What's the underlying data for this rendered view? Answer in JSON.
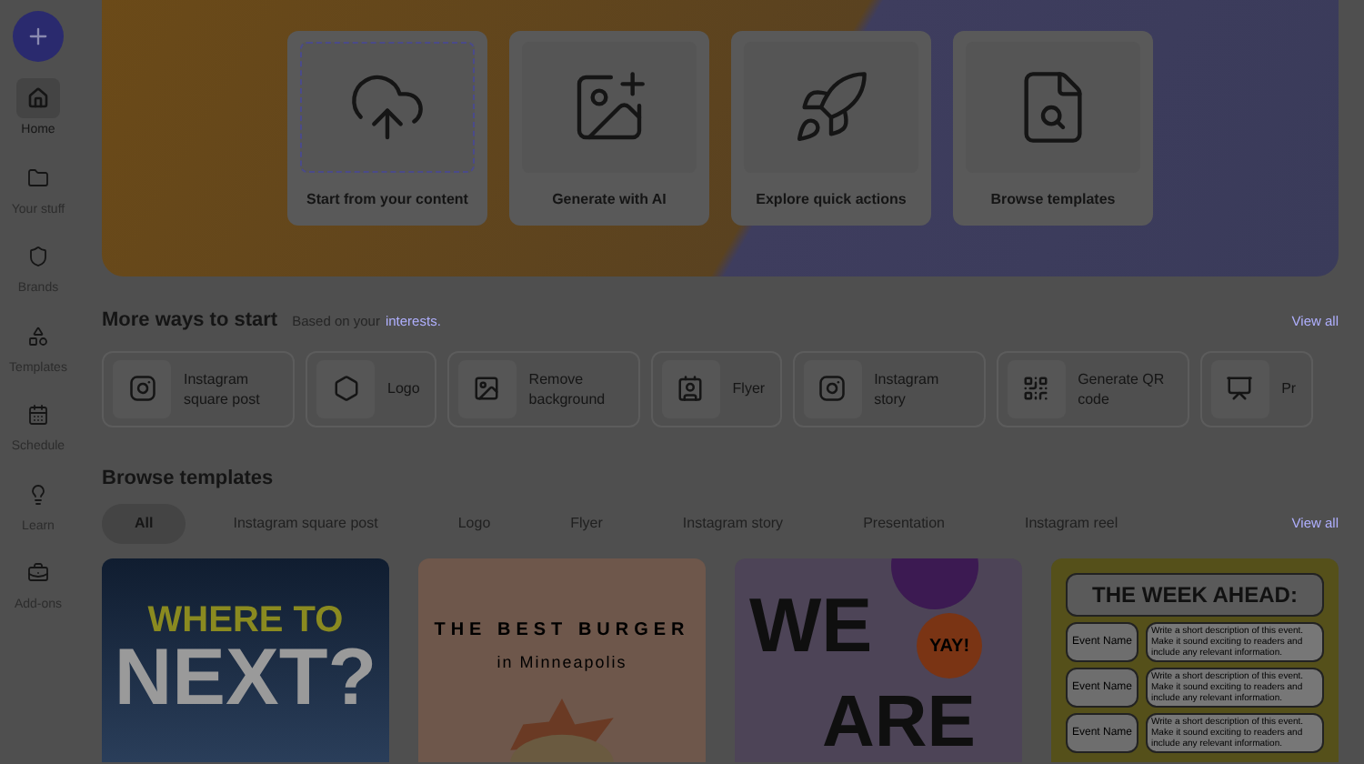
{
  "sidebar": {
    "items": [
      {
        "label": "Home",
        "selected": true
      },
      {
        "label": "Your stuff",
        "selected": false
      },
      {
        "label": "Brands",
        "selected": false
      },
      {
        "label": "Templates",
        "selected": false
      },
      {
        "label": "Schedule",
        "selected": false
      },
      {
        "label": "Learn",
        "selected": false
      },
      {
        "label": "Add-ons",
        "selected": false
      }
    ]
  },
  "hero": {
    "cards": [
      {
        "label": "Start from your content"
      },
      {
        "label": "Generate with AI"
      },
      {
        "label": "Explore quick actions"
      },
      {
        "label": "Browse templates"
      }
    ]
  },
  "more_ways": {
    "title": "More ways to start",
    "subtitle": "Based on your",
    "subtitle_link": "interests.",
    "view_all": "View all",
    "items": [
      {
        "label": "Instagram square post"
      },
      {
        "label": "Logo"
      },
      {
        "label": "Remove background"
      },
      {
        "label": "Flyer"
      },
      {
        "label": "Instagram story"
      },
      {
        "label": "Generate QR code"
      },
      {
        "label": "Pr"
      }
    ]
  },
  "browse_templates": {
    "title": "Browse templates",
    "view_all": "View all",
    "filters": [
      {
        "label": "All",
        "selected": true
      },
      {
        "label": "Instagram square post",
        "selected": false
      },
      {
        "label": "Logo",
        "selected": false
      },
      {
        "label": "Flyer",
        "selected": false
      },
      {
        "label": "Instagram story",
        "selected": false
      },
      {
        "label": "Presentation",
        "selected": false
      },
      {
        "label": "Instagram reel",
        "selected": false
      }
    ],
    "templates": [
      {
        "kind": "travel",
        "lines": [
          "WHERE TO",
          "NEXT?"
        ]
      },
      {
        "kind": "burger",
        "lines": [
          "THE BEST BURGER",
          "in Minneapolis"
        ]
      },
      {
        "kind": "party",
        "lines": [
          "WE",
          "YAY!",
          "ARE"
        ]
      },
      {
        "kind": "schedule",
        "lines": [
          "THE WEEK AHEAD:"
        ],
        "events": [
          {
            "name": "Event Name",
            "description": "Write a short description of this event. Make it sound exciting to readers and include any relevant information."
          },
          {
            "name": "Event Name",
            "description": "Write a short description of this event. Make it sound exciting to readers and include any relevant information."
          },
          {
            "name": "Event Name",
            "description": "Write a short description of this event. Make it sound exciting to readers and include any relevant information."
          }
        ]
      }
    ]
  }
}
